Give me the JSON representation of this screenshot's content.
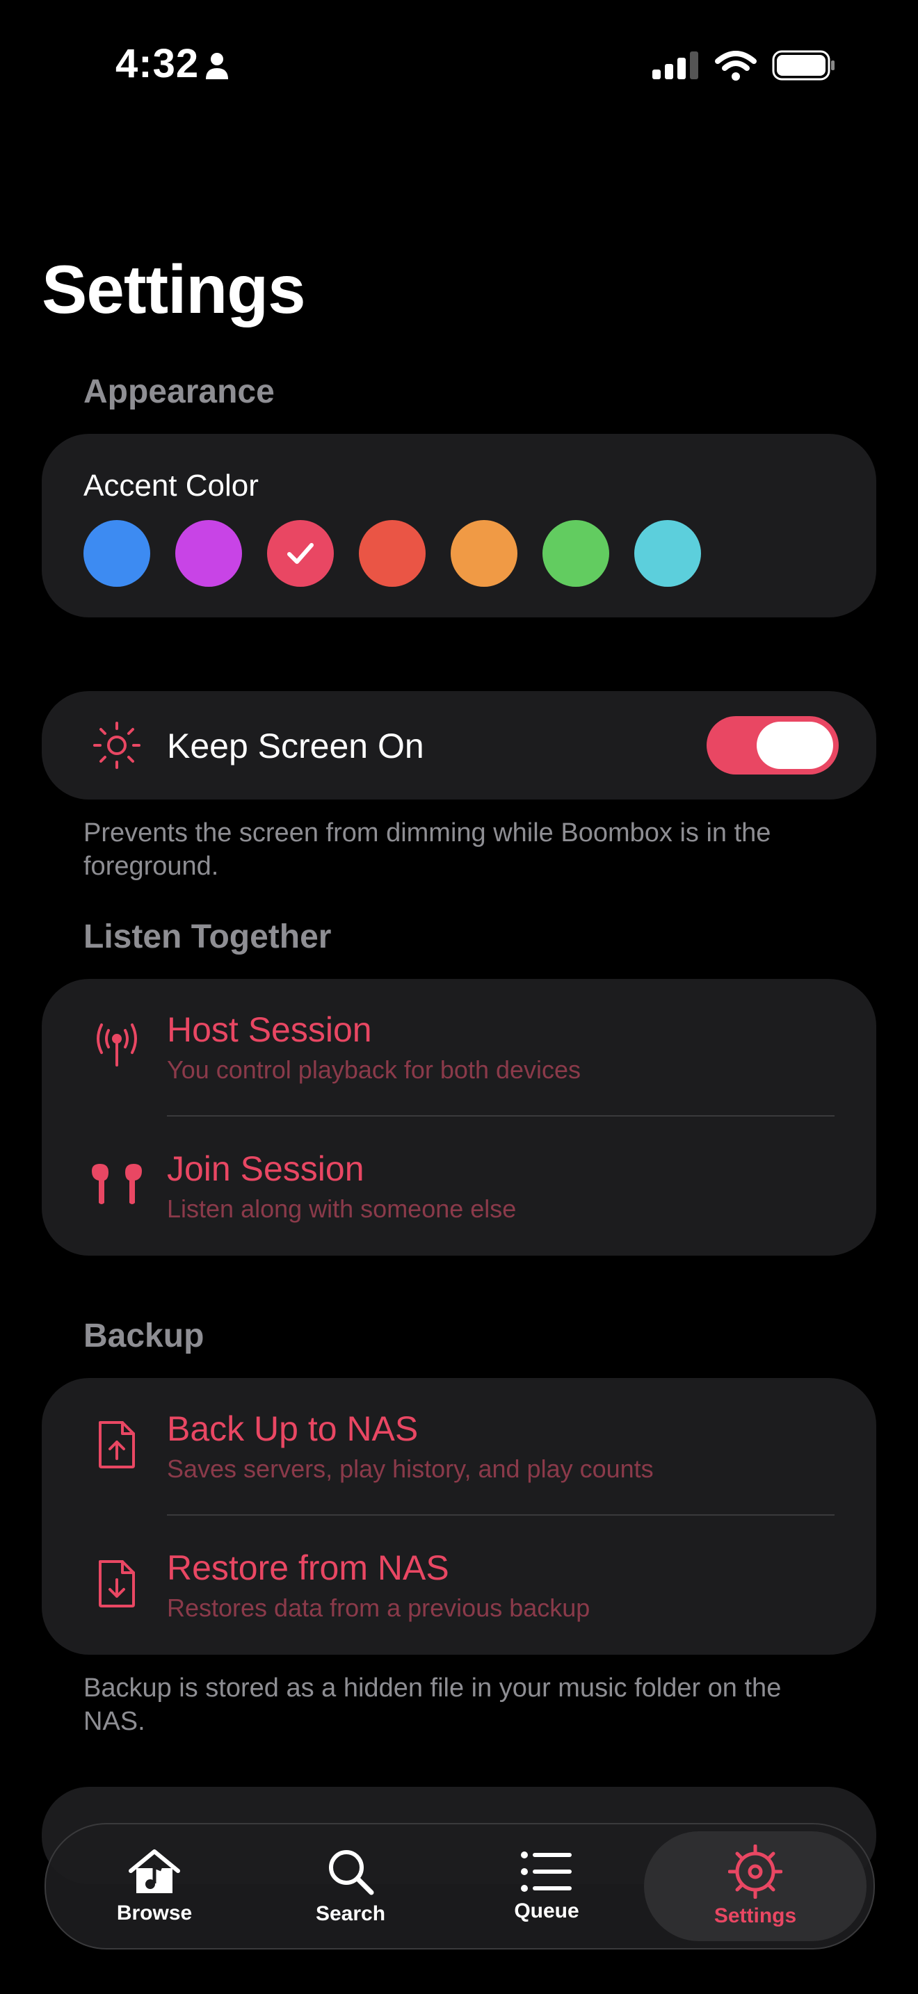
{
  "status": {
    "time": "4:32"
  },
  "page": {
    "title": "Settings"
  },
  "appearance": {
    "section": "Appearance",
    "accent_title": "Accent Color",
    "colors": [
      "#3d8bf2",
      "#c844e6",
      "#e94763",
      "#ea5545",
      "#f09a45",
      "#62cc60",
      "#5ccfdc"
    ],
    "selected_index": 2
  },
  "keep_screen": {
    "label": "Keep Screen On",
    "enabled": true,
    "footnote": "Prevents the screen from dimming while Boombox is in the foreground."
  },
  "listen_together": {
    "section": "Listen Together",
    "host_title": "Host Session",
    "host_sub": "You control playback for both devices",
    "join_title": "Join Session",
    "join_sub": "Listen along with someone else"
  },
  "backup": {
    "section": "Backup",
    "backup_title": "Back Up to NAS",
    "backup_sub": "Saves servers, play history, and play counts",
    "restore_title": "Restore from NAS",
    "restore_sub": "Restores data from a previous backup",
    "footnote": "Backup is stored as a hidden file in your music folder on the NAS."
  },
  "tabs": {
    "browse": "Browse",
    "search": "Search",
    "queue": "Queue",
    "settings": "Settings"
  },
  "colors": {
    "accent": "#e94763",
    "card": "#1c1c1e",
    "muted": "#8e8e93"
  }
}
